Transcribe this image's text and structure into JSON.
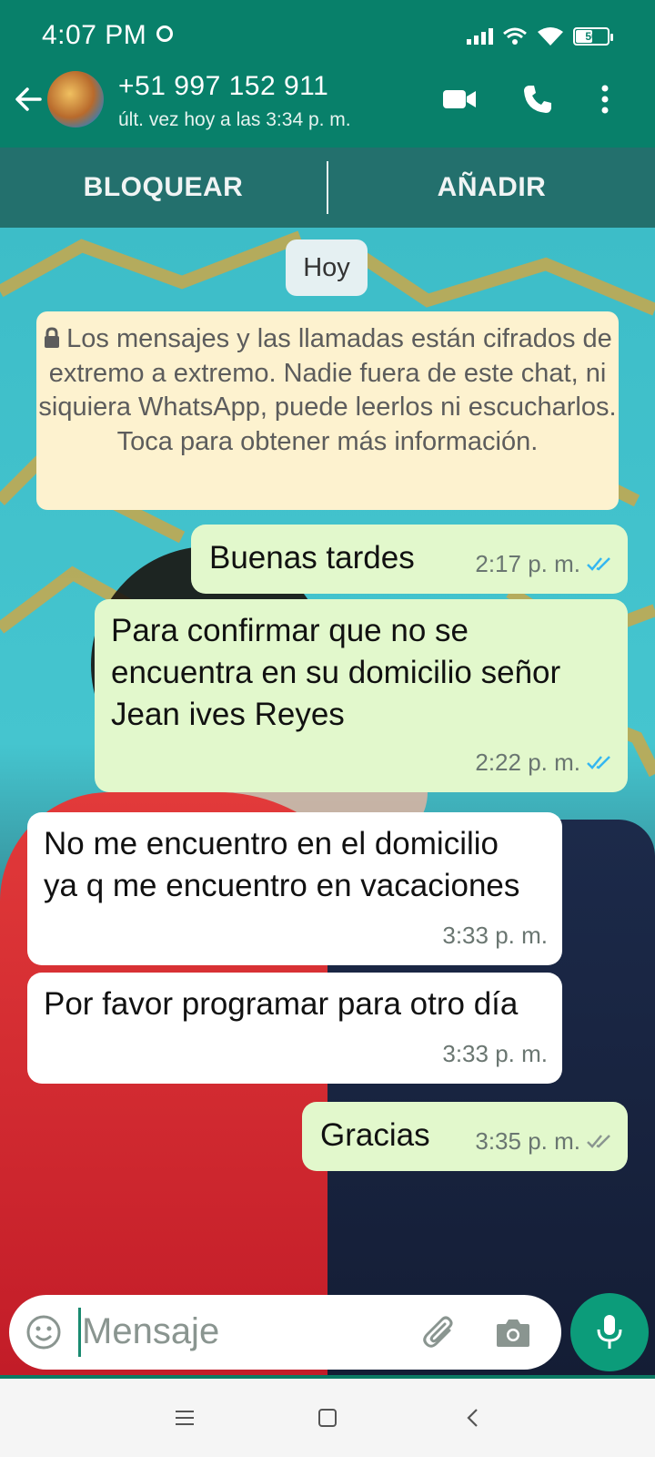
{
  "status_bar": {
    "time": "4:07 PM",
    "battery": "50"
  },
  "header": {
    "contact": "+51 997 152 911",
    "last_seen": "últ. vez hoy a las 3:34 p. m.",
    "icons": [
      "back-arrow-icon",
      "video-call-icon",
      "phone-icon",
      "more-vertical-icon"
    ]
  },
  "actions": {
    "block": "BLOQUEAR",
    "add": "AÑADIR"
  },
  "chat": {
    "day": "Hoy",
    "encryption_notice": "Los mensajes y las llamadas están cifrados de extremo a extremo. Nadie fuera de este chat, ni siquiera WhatsApp, puede leerlos ni escucharlos. Toca para obtener más información.",
    "messages": [
      {
        "dir": "out",
        "text": "Buenas tardes",
        "time": "2:17 p. m.",
        "status": "read"
      },
      {
        "dir": "out",
        "text": "Para confirmar que no se encuentra en su domicilio señor Jean ives Reyes",
        "time": "2:22 p. m.",
        "status": "read"
      },
      {
        "dir": "in",
        "text": "No me encuentro en el domicilio ya q me encuentro en vacaciones",
        "time": "3:33 p. m."
      },
      {
        "dir": "in",
        "text": "Por favor programar para otro día",
        "time": "3:33 p. m."
      },
      {
        "dir": "out",
        "text": "Gracias",
        "time": "3:35 p. m.",
        "status": "delivered"
      }
    ]
  },
  "composer": {
    "placeholder": "Mensaje",
    "icons": [
      "emoji-icon",
      "attach-icon",
      "camera-icon",
      "mic-icon"
    ]
  },
  "colors": {
    "header": "#08806a",
    "outgoing_bubble": "#e2f8cc",
    "incoming_bubble": "#ffffff",
    "read_tick": "#34b7f1",
    "accent": "#0c9c7a"
  }
}
